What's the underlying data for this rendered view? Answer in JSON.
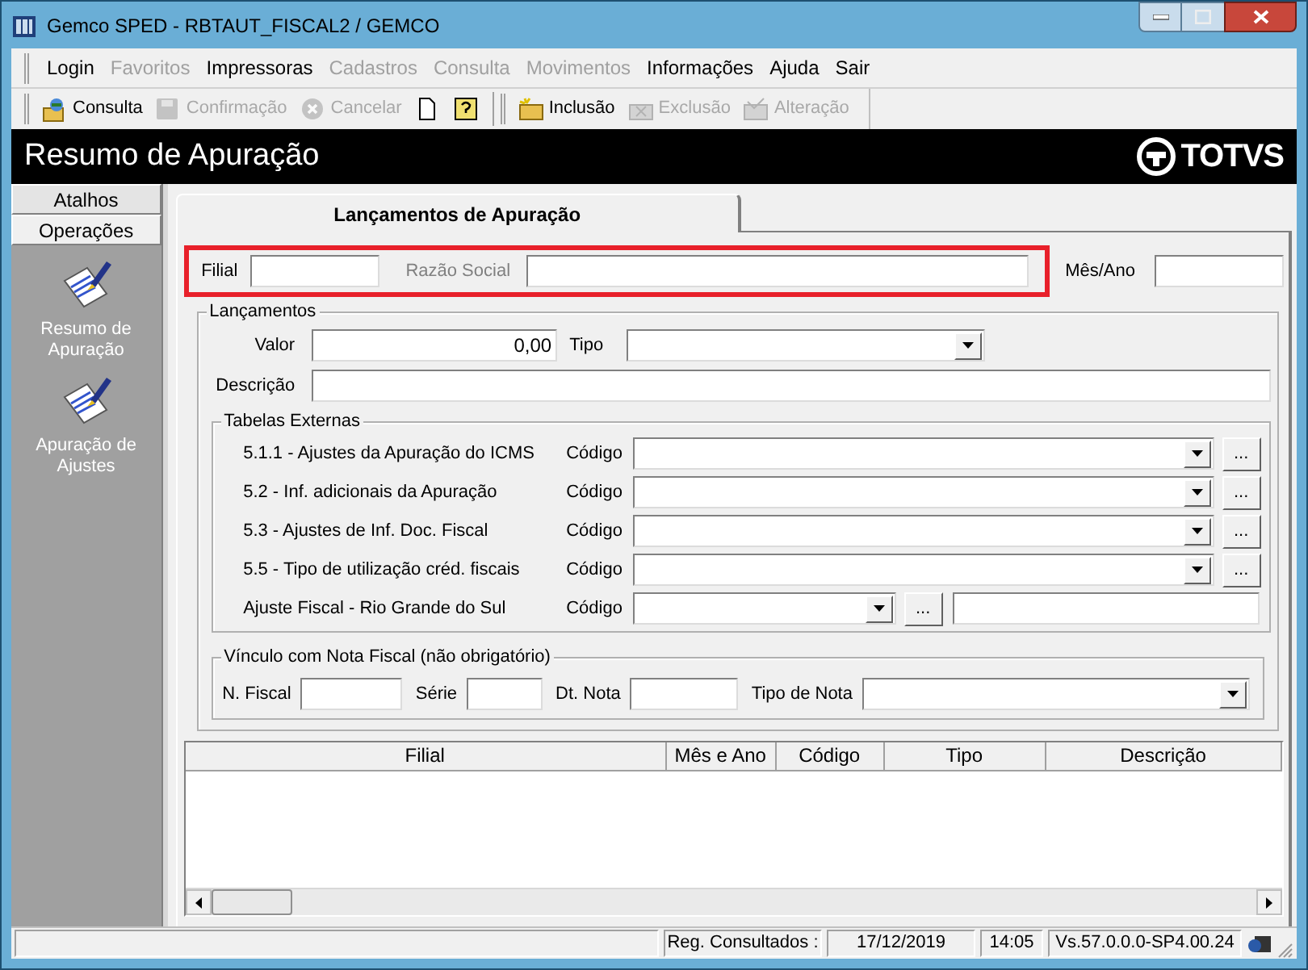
{
  "window": {
    "title": "Gemco SPED - RBTAUT_FISCAL2 / GEMCO"
  },
  "menu": [
    {
      "label": "Login",
      "disabled": false
    },
    {
      "label": "Favoritos",
      "disabled": true
    },
    {
      "label": "Impressoras",
      "disabled": false
    },
    {
      "label": "Cadastros",
      "disabled": true
    },
    {
      "label": "Consulta",
      "disabled": true
    },
    {
      "label": "Movimentos",
      "disabled": true
    },
    {
      "label": "Informações",
      "disabled": false
    },
    {
      "label": "Ajuda",
      "disabled": false
    },
    {
      "label": "Sair",
      "disabled": false
    }
  ],
  "toolbar": [
    {
      "kind": "button",
      "label": "Consulta",
      "disabled": false
    },
    {
      "kind": "button",
      "label": "Confirmação",
      "disabled": true
    },
    {
      "kind": "button",
      "label": "Cancelar",
      "disabled": true
    },
    {
      "kind": "icon",
      "disabled": false
    },
    {
      "kind": "icon",
      "disabled": false
    },
    {
      "kind": "separator"
    },
    {
      "kind": "button",
      "label": "Inclusão",
      "disabled": false
    },
    {
      "kind": "button",
      "label": "Exclusão",
      "disabled": true
    },
    {
      "kind": "button",
      "label": "Alteração",
      "disabled": true
    }
  ],
  "header": {
    "title": "Resumo de Apuração",
    "logo": "TOTVS"
  },
  "sidebar": {
    "tabs": [
      {
        "label": "Atalhos",
        "selected": false
      },
      {
        "label": "Operações",
        "selected": true
      }
    ],
    "items": [
      {
        "label": "Resumo de Apuração"
      },
      {
        "label": "Apuração de Ajustes"
      }
    ]
  },
  "tab": {
    "label": "Lançamentos de Apuração",
    "selected": true
  },
  "filter": {
    "highlighted": true,
    "filial_label": "Filial",
    "razao_label": "Razão Social",
    "razao_disabled": true,
    "mes_ano_label": "Mês/Ano"
  },
  "lancamentos": {
    "legend": "Lançamentos",
    "valor_label": "Valor",
    "valor": "0,00",
    "tipo_label": "Tipo",
    "descricao_label": "Descrição"
  },
  "tabelas_externas": {
    "legend": "Tabelas Externas",
    "rows": [
      {
        "kind": "lookup",
        "label": "5.1.1 - Ajustes da Apuração do ICMS",
        "code_label": "Código",
        "button": "..."
      },
      {
        "kind": "lookup",
        "label": "5.2 - Inf. adicionais da Apuração",
        "code_label": "Código",
        "button": "..."
      },
      {
        "kind": "lookup",
        "label": "5.3 - Ajustes de Inf. Doc. Fiscal",
        "code_label": "Código",
        "button": "..."
      },
      {
        "kind": "lookup",
        "label": "5.5 - Tipo de utilização créd. fiscais",
        "code_label": "Código",
        "button": "..."
      },
      {
        "kind": "lookup_text",
        "label": "Ajuste Fiscal - Rio Grande do Sul",
        "code_label": "Código",
        "button": "..."
      }
    ]
  },
  "vinculo": {
    "legend": "Vínculo com Nota Fiscal (não obrigatório)",
    "n_fiscal_label": "N. Fiscal",
    "serie_label": "Série",
    "dt_nota_label": "Dt. Nota",
    "tipo_nota_label": "Tipo de Nota"
  },
  "table": {
    "columns": [
      "Filial",
      "Mês e Ano",
      "Código",
      "Tipo",
      "Descrição"
    ]
  },
  "status_bar": [
    "Reg. Consultados :",
    "17/12/2019",
    "14:05",
    "Vs.57.0.0.0-SP4.00.24"
  ]
}
